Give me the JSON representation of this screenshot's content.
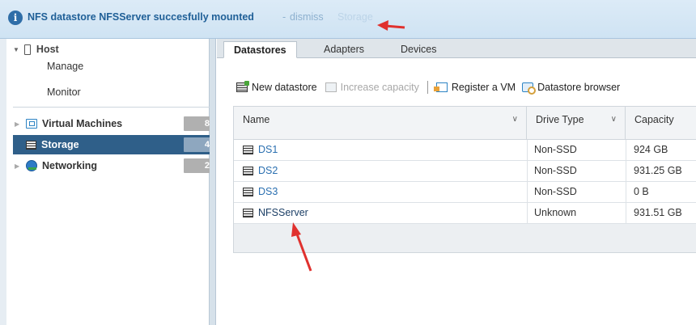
{
  "banner": {
    "message": "NFS datastore NFSServer succesfully mounted",
    "separator": "-",
    "dismiss_label": "dismiss",
    "ghost_text": "Storage"
  },
  "sidebar": {
    "host": {
      "label": "Host",
      "items": [
        "Manage",
        "Monitor"
      ]
    },
    "nav": [
      {
        "label": "Virtual Machines",
        "count": "8",
        "icon": "vm-icon",
        "active": false
      },
      {
        "label": "Storage",
        "count": "4",
        "icon": "storage-icon",
        "active": true
      },
      {
        "label": "Networking",
        "count": "2",
        "icon": "network-icon",
        "active": false
      }
    ]
  },
  "tabs": [
    "Datastores",
    "Adapters",
    "Devices"
  ],
  "active_tab": "Datastores",
  "toolbar": {
    "new_datastore": "New datastore",
    "increase_capacity": "Increase capacity",
    "register_vm": "Register a VM",
    "datastore_browser": "Datastore browser"
  },
  "table": {
    "columns": [
      "Name",
      "Drive Type",
      "Capacity"
    ],
    "rows": [
      {
        "name": "DS1",
        "drive_type": "Non-SSD",
        "capacity": "924 GB"
      },
      {
        "name": "DS2",
        "drive_type": "Non-SSD",
        "capacity": "931.25 GB"
      },
      {
        "name": "DS3",
        "drive_type": "Non-SSD",
        "capacity": "0 B"
      },
      {
        "name": "NFSServer",
        "drive_type": "Unknown",
        "capacity": "931.51 GB"
      }
    ]
  },
  "colors": {
    "accent": "#2f5f89",
    "link": "#2a6fb0",
    "annotation_arrow": "#e0312e"
  }
}
